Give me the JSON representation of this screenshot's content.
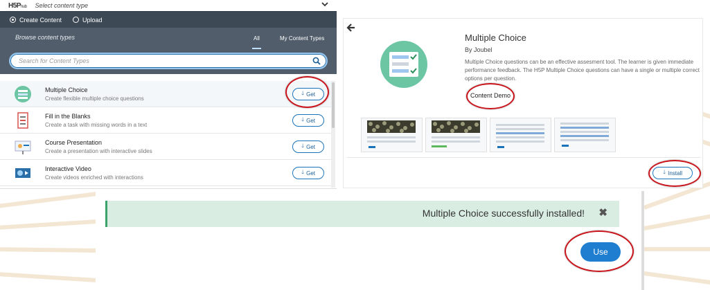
{
  "header": {
    "logo": "H5P",
    "logo_sub": "hub",
    "title": "Select content type"
  },
  "mode": {
    "create": "Create Content",
    "upload": "Upload"
  },
  "browse": {
    "title": "Browse content types",
    "tab_all": "All",
    "tab_mine": "My Content Types",
    "search_placeholder": "Search for Content Types"
  },
  "items": [
    {
      "title": "Multiple Choice",
      "desc": "Create flexible multiple choice questions",
      "action": "Get"
    },
    {
      "title": "Fill in the Blanks",
      "desc": "Create a task with missing words in a text",
      "action": "Get"
    },
    {
      "title": "Course Presentation",
      "desc": "Create a presentation with interactive slides",
      "action": "Get"
    },
    {
      "title": "Interactive Video",
      "desc": "Create videos enriched with interactions",
      "action": "Get"
    }
  ],
  "detail": {
    "title": "Multiple Choice",
    "author": "By Joubel",
    "description": "Multiple Choice questions can be an effective assesment tool. The learner is given immediate performance feedback. The H5P Multiple Choice questions can have a single or multiple correct options per question.",
    "demo_label": "Content Demo",
    "install_label": "Install"
  },
  "alert": {
    "message": "Multiple Choice successfully installed!",
    "close": "✖"
  },
  "use_label": "Use",
  "colors": {
    "dark_bar": "#3d4a56",
    "browse_bar": "#515d6b",
    "accent": "#1f7ed0",
    "success_bg": "#d9ede3",
    "highlight_ring": "#c9141c",
    "logo_green": "#6cc6a4"
  }
}
